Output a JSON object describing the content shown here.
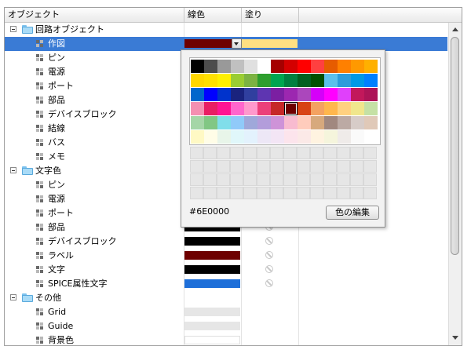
{
  "header": {
    "col_object": "オブジェクト",
    "col_line": "線色",
    "col_fill": "塗り"
  },
  "tree": {
    "groups": [
      {
        "label": "回路オブジェクト",
        "items": [
          {
            "label": "作図",
            "line": "#6E0000",
            "fill": "#FFE082",
            "selected": true
          },
          {
            "label": "ピン"
          },
          {
            "label": "電源"
          },
          {
            "label": "ポート"
          },
          {
            "label": "部品"
          },
          {
            "label": "デバイスブロック"
          },
          {
            "label": "結線"
          },
          {
            "label": "バス"
          },
          {
            "label": "メモ"
          }
        ]
      },
      {
        "label": "文字色",
        "items": [
          {
            "label": "ピン"
          },
          {
            "label": "電源"
          },
          {
            "label": "ポート"
          },
          {
            "label": "部品",
            "line": "#000000"
          },
          {
            "label": "デバイスブロック",
            "line": "#000000"
          },
          {
            "label": "ラベル",
            "line": "#6E0000"
          },
          {
            "label": "文字",
            "line": "#000000"
          },
          {
            "label": "SPICE属性文字",
            "line": "#1E6FD9"
          }
        ]
      },
      {
        "label": "その他",
        "items": [
          {
            "label": "Grid",
            "line": "#E6E6E6"
          },
          {
            "label": "Guide",
            "line": "#E6E6E6"
          },
          {
            "label": "背景色",
            "line": "#FFFFFF"
          }
        ]
      }
    ]
  },
  "picker": {
    "hex": "#6E0000",
    "edit_label": "色の編集",
    "selected": "#6E0000",
    "rows": [
      [
        "#000000",
        "#4D4D4D",
        "#999999",
        "#C0C0C0",
        "#E0E0E0",
        "#FFFFFF",
        "#A50000",
        "#D40000",
        "#FF0000",
        "#FF4040",
        "#E65C00",
        "#FF8000",
        "#FF9900",
        "#FFB000"
      ],
      [
        "#FFD700",
        "#FFE000",
        "#FFF000",
        "#9ACD32",
        "#7CB342",
        "#2E9E2E",
        "#00A550",
        "#008040",
        "#006020",
        "#005000",
        "#5BC0EB",
        "#2D9CDB",
        "#0099E6",
        "#0080FF"
      ],
      [
        "#0066CC",
        "#0000FF",
        "#0033CC",
        "#1A237E",
        "#303F9F",
        "#5E35B1",
        "#7B1FA2",
        "#9C27B0",
        "#AB47BC",
        "#D500F9",
        "#FF00FF",
        "#E040FB",
        "#C2185B",
        "#AD1457"
      ],
      [
        "#F48FB1",
        "#E91E63",
        "#FF1493",
        "#FF66CC",
        "#FF99CC",
        "#EC407A",
        "#C62828",
        "#6E0000",
        "#D84315",
        "#F4A261",
        "#FFB74D",
        "#FFD180",
        "#F0E68C",
        "#C5E1A5"
      ],
      [
        "#A5D6A7",
        "#81C784",
        "#80DEEA",
        "#90CAF9",
        "#9FA8DA",
        "#B39DDB",
        "#CE93D8",
        "#F8BBD0",
        "#FFCCBC",
        "#D7A97D",
        "#A1887F",
        "#BCAAA4",
        "#D7CCC8",
        "#E0C9B8"
      ],
      [
        "#FFF9C4",
        "#FFFDE7",
        "#E8F5E9",
        "#E0F7FA",
        "#E3F2FD",
        "#EDE7F6",
        "#F3E5F5",
        "#FCE4EC",
        "#FBE9E7",
        "#FFF3E0",
        "#F5F5DC",
        "#EFEBE9",
        "#FAFAFA",
        "#FFFFFF"
      ]
    ]
  }
}
